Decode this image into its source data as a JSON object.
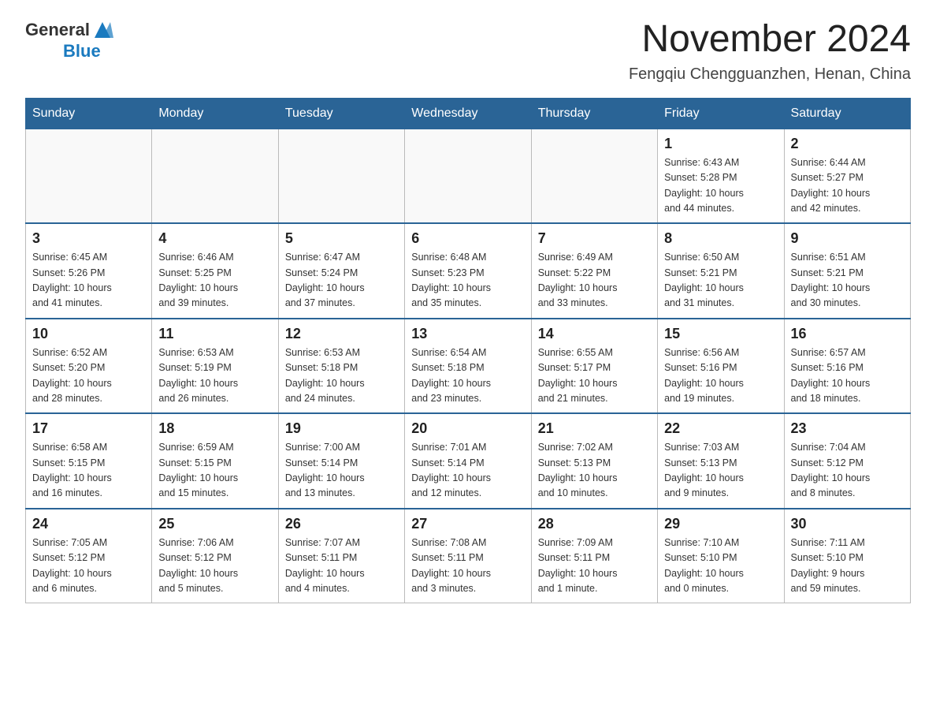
{
  "logo": {
    "general": "General",
    "blue": "Blue"
  },
  "title": "November 2024",
  "location": "Fengqiu Chengguanzhen, Henan, China",
  "weekdays": [
    "Sunday",
    "Monday",
    "Tuesday",
    "Wednesday",
    "Thursday",
    "Friday",
    "Saturday"
  ],
  "weeks": [
    [
      {
        "day": "",
        "info": ""
      },
      {
        "day": "",
        "info": ""
      },
      {
        "day": "",
        "info": ""
      },
      {
        "day": "",
        "info": ""
      },
      {
        "day": "",
        "info": ""
      },
      {
        "day": "1",
        "info": "Sunrise: 6:43 AM\nSunset: 5:28 PM\nDaylight: 10 hours\nand 44 minutes."
      },
      {
        "day": "2",
        "info": "Sunrise: 6:44 AM\nSunset: 5:27 PM\nDaylight: 10 hours\nand 42 minutes."
      }
    ],
    [
      {
        "day": "3",
        "info": "Sunrise: 6:45 AM\nSunset: 5:26 PM\nDaylight: 10 hours\nand 41 minutes."
      },
      {
        "day": "4",
        "info": "Sunrise: 6:46 AM\nSunset: 5:25 PM\nDaylight: 10 hours\nand 39 minutes."
      },
      {
        "day": "5",
        "info": "Sunrise: 6:47 AM\nSunset: 5:24 PM\nDaylight: 10 hours\nand 37 minutes."
      },
      {
        "day": "6",
        "info": "Sunrise: 6:48 AM\nSunset: 5:23 PM\nDaylight: 10 hours\nand 35 minutes."
      },
      {
        "day": "7",
        "info": "Sunrise: 6:49 AM\nSunset: 5:22 PM\nDaylight: 10 hours\nand 33 minutes."
      },
      {
        "day": "8",
        "info": "Sunrise: 6:50 AM\nSunset: 5:21 PM\nDaylight: 10 hours\nand 31 minutes."
      },
      {
        "day": "9",
        "info": "Sunrise: 6:51 AM\nSunset: 5:21 PM\nDaylight: 10 hours\nand 30 minutes."
      }
    ],
    [
      {
        "day": "10",
        "info": "Sunrise: 6:52 AM\nSunset: 5:20 PM\nDaylight: 10 hours\nand 28 minutes."
      },
      {
        "day": "11",
        "info": "Sunrise: 6:53 AM\nSunset: 5:19 PM\nDaylight: 10 hours\nand 26 minutes."
      },
      {
        "day": "12",
        "info": "Sunrise: 6:53 AM\nSunset: 5:18 PM\nDaylight: 10 hours\nand 24 minutes."
      },
      {
        "day": "13",
        "info": "Sunrise: 6:54 AM\nSunset: 5:18 PM\nDaylight: 10 hours\nand 23 minutes."
      },
      {
        "day": "14",
        "info": "Sunrise: 6:55 AM\nSunset: 5:17 PM\nDaylight: 10 hours\nand 21 minutes."
      },
      {
        "day": "15",
        "info": "Sunrise: 6:56 AM\nSunset: 5:16 PM\nDaylight: 10 hours\nand 19 minutes."
      },
      {
        "day": "16",
        "info": "Sunrise: 6:57 AM\nSunset: 5:16 PM\nDaylight: 10 hours\nand 18 minutes."
      }
    ],
    [
      {
        "day": "17",
        "info": "Sunrise: 6:58 AM\nSunset: 5:15 PM\nDaylight: 10 hours\nand 16 minutes."
      },
      {
        "day": "18",
        "info": "Sunrise: 6:59 AM\nSunset: 5:15 PM\nDaylight: 10 hours\nand 15 minutes."
      },
      {
        "day": "19",
        "info": "Sunrise: 7:00 AM\nSunset: 5:14 PM\nDaylight: 10 hours\nand 13 minutes."
      },
      {
        "day": "20",
        "info": "Sunrise: 7:01 AM\nSunset: 5:14 PM\nDaylight: 10 hours\nand 12 minutes."
      },
      {
        "day": "21",
        "info": "Sunrise: 7:02 AM\nSunset: 5:13 PM\nDaylight: 10 hours\nand 10 minutes."
      },
      {
        "day": "22",
        "info": "Sunrise: 7:03 AM\nSunset: 5:13 PM\nDaylight: 10 hours\nand 9 minutes."
      },
      {
        "day": "23",
        "info": "Sunrise: 7:04 AM\nSunset: 5:12 PM\nDaylight: 10 hours\nand 8 minutes."
      }
    ],
    [
      {
        "day": "24",
        "info": "Sunrise: 7:05 AM\nSunset: 5:12 PM\nDaylight: 10 hours\nand 6 minutes."
      },
      {
        "day": "25",
        "info": "Sunrise: 7:06 AM\nSunset: 5:12 PM\nDaylight: 10 hours\nand 5 minutes."
      },
      {
        "day": "26",
        "info": "Sunrise: 7:07 AM\nSunset: 5:11 PM\nDaylight: 10 hours\nand 4 minutes."
      },
      {
        "day": "27",
        "info": "Sunrise: 7:08 AM\nSunset: 5:11 PM\nDaylight: 10 hours\nand 3 minutes."
      },
      {
        "day": "28",
        "info": "Sunrise: 7:09 AM\nSunset: 5:11 PM\nDaylight: 10 hours\nand 1 minute."
      },
      {
        "day": "29",
        "info": "Sunrise: 7:10 AM\nSunset: 5:10 PM\nDaylight: 10 hours\nand 0 minutes."
      },
      {
        "day": "30",
        "info": "Sunrise: 7:11 AM\nSunset: 5:10 PM\nDaylight: 9 hours\nand 59 minutes."
      }
    ]
  ]
}
